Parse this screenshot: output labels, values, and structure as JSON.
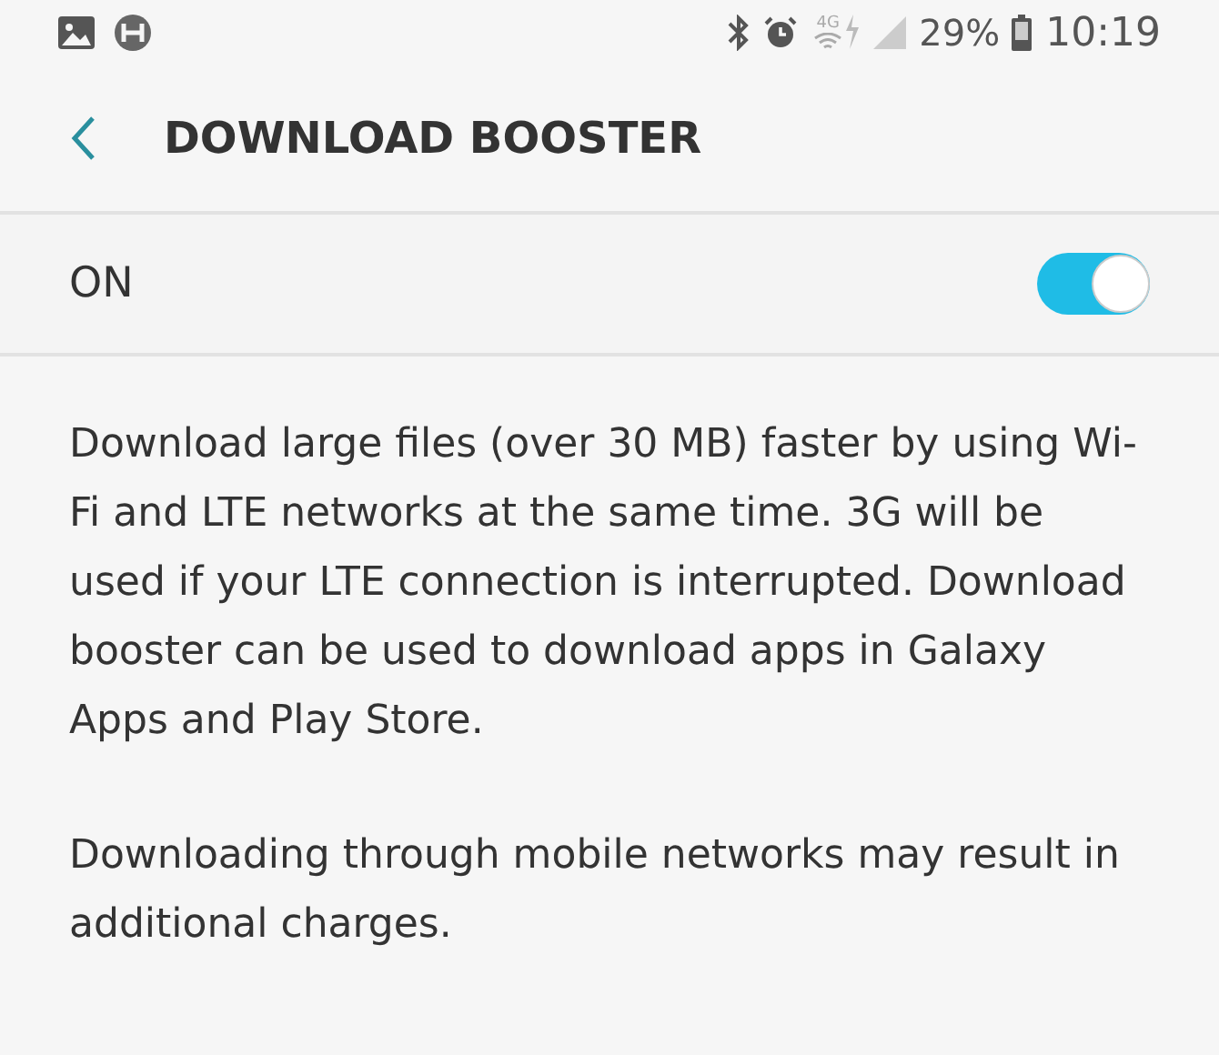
{
  "status_bar": {
    "network_label": "4G",
    "battery": "29%",
    "time": "10:19"
  },
  "header": {
    "title": "DOWNLOAD BOOSTER"
  },
  "master_switch": {
    "label": "ON",
    "on": true
  },
  "description": [
    "Download large files (over 30 MB) faster by using Wi-Fi and LTE networks at the same time. 3G will be used if your LTE connection is interrupted. Download booster can be used to download apps in Galaxy Apps and Play Store.",
    "Downloading through mobile networks may result in additional charges."
  ]
}
